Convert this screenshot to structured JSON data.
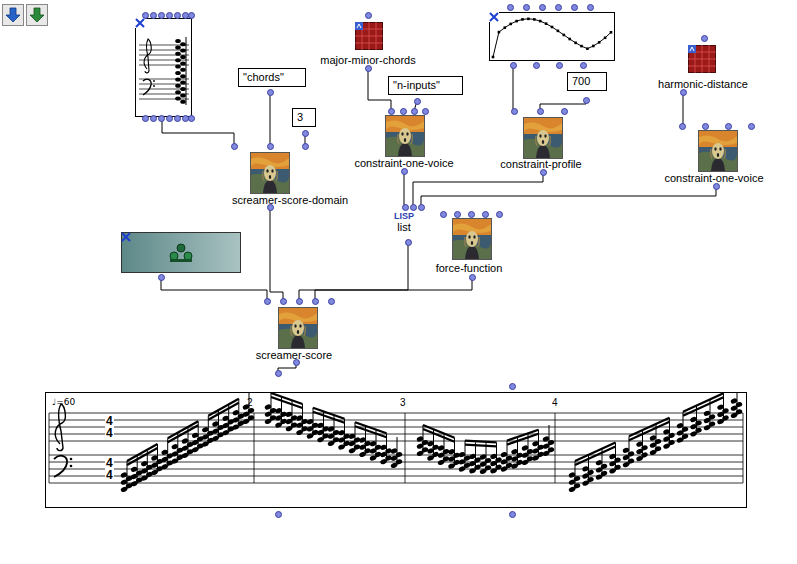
{
  "constants": [
    {
      "text": "\"chords\""
    },
    {
      "text": "3"
    },
    {
      "text": "\"n-inputs\""
    },
    {
      "text": "700"
    }
  ],
  "functions": [
    {
      "label": "screamer-score-domain"
    },
    {
      "label": "constraint-one-voice"
    },
    {
      "label": "constraint-profile"
    },
    {
      "label": "constraint-one-voice"
    },
    {
      "label": "force-function"
    },
    {
      "label": "screamer-score"
    }
  ],
  "patches": [
    {
      "label": "major-minor-chords"
    },
    {
      "label": "harmonic-distance"
    }
  ],
  "lisp_function": {
    "tag": "LISP",
    "label": "list"
  },
  "score": {
    "tempo": "♩=60",
    "time_signature": {
      "treble": [
        "4",
        "4"
      ],
      "bass": [
        "4",
        "4"
      ]
    },
    "measure_numbers": [
      "2",
      "3",
      "4"
    ]
  }
}
